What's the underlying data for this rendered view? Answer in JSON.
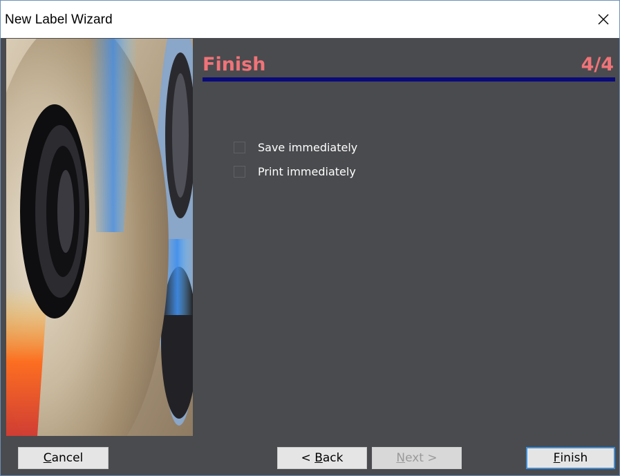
{
  "window": {
    "title": "New Label Wizard"
  },
  "page": {
    "heading": "Finish",
    "step": "4/4"
  },
  "options": [
    {
      "label": "Save immediately",
      "checked": false
    },
    {
      "label": "Print immediately",
      "checked": false
    }
  ],
  "buttons": {
    "cancel": {
      "mnemonic": "C",
      "rest": "ancel"
    },
    "back": {
      "prefix": "< ",
      "mnemonic": "B",
      "rest": "ack"
    },
    "next": {
      "mnemonic": "N",
      "rest": "ext",
      "suffix": " >",
      "enabled": false
    },
    "finish": {
      "mnemonic": "F",
      "rest": "inish",
      "default": true
    }
  },
  "colors": {
    "heading": "#f07378",
    "rule": "#0a0a7a",
    "panel": "#4a4b4e",
    "focus_border": "#3d8fdb"
  },
  "icons": {
    "close": "close-icon",
    "side_image": "compact-disc-illustration"
  }
}
